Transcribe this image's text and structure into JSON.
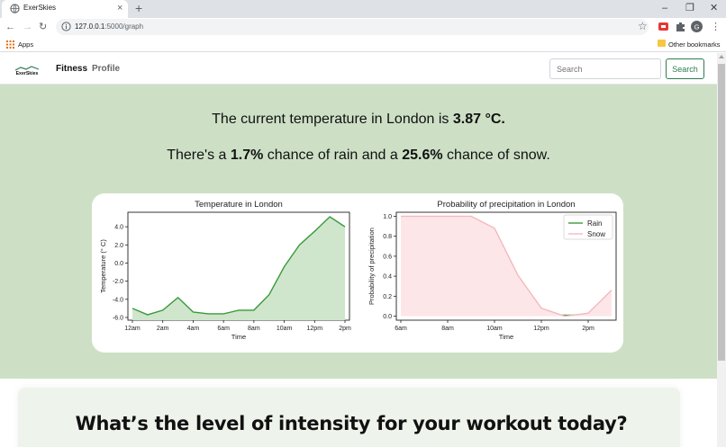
{
  "browser": {
    "tab_title": "ExerSkies",
    "tab_close_glyph": "×",
    "new_tab_glyph": "+",
    "url_host": "127.0.0.1",
    "url_path": ":5000/graph",
    "profile_initial": "G",
    "bookmarks": {
      "apps_label": "Apps",
      "other_label": "Other bookmarks"
    },
    "icons": [
      "globe-icon",
      "close-icon",
      "plus-icon",
      "minimize-icon",
      "restore-icon",
      "window-close-icon",
      "back-icon",
      "forward-icon",
      "reload-icon",
      "info-icon",
      "star-icon",
      "extension-red-icon",
      "puzzle-icon",
      "more-icon",
      "apps-grid-icon",
      "folder-icon"
    ]
  },
  "nav": {
    "brand": "ExerSkies",
    "fitness": "Fitness",
    "profile": "Profile",
    "search_placeholder": "Search",
    "search_button": "Search"
  },
  "weather": {
    "temp_prefix": "The current temperature in London is ",
    "temp_value": "3.87 °C.",
    "rain_prefix": "There's a ",
    "rain_value": "1.7%",
    "rain_mid": " chance of rain and a ",
    "snow_value": "25.6%",
    "snow_suffix": " chance of snow."
  },
  "chart_data": [
    {
      "type": "area",
      "title": "Temperature in London",
      "xlabel": "Time",
      "ylabel": "Temperature (° C)",
      "x": [
        "12am",
        "1am",
        "2am",
        "3am",
        "4am",
        "5am",
        "6am",
        "7am",
        "8am",
        "9am",
        "10am",
        "11am",
        "12pm",
        "1pm",
        "2pm"
      ],
      "xticks": [
        "12am",
        "2am",
        "4am",
        "6am",
        "8am",
        "10am",
        "12pm",
        "2pm"
      ],
      "yticks": [
        "4.0",
        "2.0",
        "0.0",
        "-2.0",
        "-4.0",
        "-6.0"
      ],
      "values": [
        -5.0,
        -5.7,
        -5.2,
        -3.8,
        -5.4,
        -5.6,
        -5.6,
        -5.2,
        -5.2,
        -3.5,
        -0.4,
        2.0,
        3.5,
        5.1,
        4.0
      ],
      "ylim": [
        -6.3,
        5.6
      ],
      "color": "#3a9a3a",
      "fill": "#cfe6cd"
    },
    {
      "type": "line",
      "title": "Probability of precipitation in London",
      "xlabel": "Time",
      "ylabel": "Probability of precipitation",
      "x": [
        "6am",
        "7am",
        "8am",
        "9am",
        "10am",
        "11am",
        "12pm",
        "1pm",
        "2pm",
        "3pm"
      ],
      "xticks": [
        "6am",
        "8am",
        "10am",
        "12pm",
        "2pm"
      ],
      "yticks": [
        "1.0",
        "0.8",
        "0.6",
        "0.4",
        "0.2",
        "0.0"
      ],
      "ylim": [
        -0.04,
        1.04
      ],
      "legend_position": "top-right",
      "series": [
        {
          "name": "Rain",
          "color": "#3a9a3a",
          "values": [
            0.01,
            0.01,
            0.02,
            0.01,
            0.01,
            0.01,
            0.01,
            0.01,
            0.01,
            0.01
          ]
        },
        {
          "name": "Snow",
          "color": "#f4b8c0",
          "fill": "#fde6e8",
          "values": [
            1.0,
            1.0,
            1.0,
            1.0,
            0.88,
            0.41,
            0.08,
            0.0,
            0.03,
            0.26
          ]
        }
      ]
    }
  ],
  "workout": {
    "question": "What’s the level of intensity for your workout today?"
  }
}
